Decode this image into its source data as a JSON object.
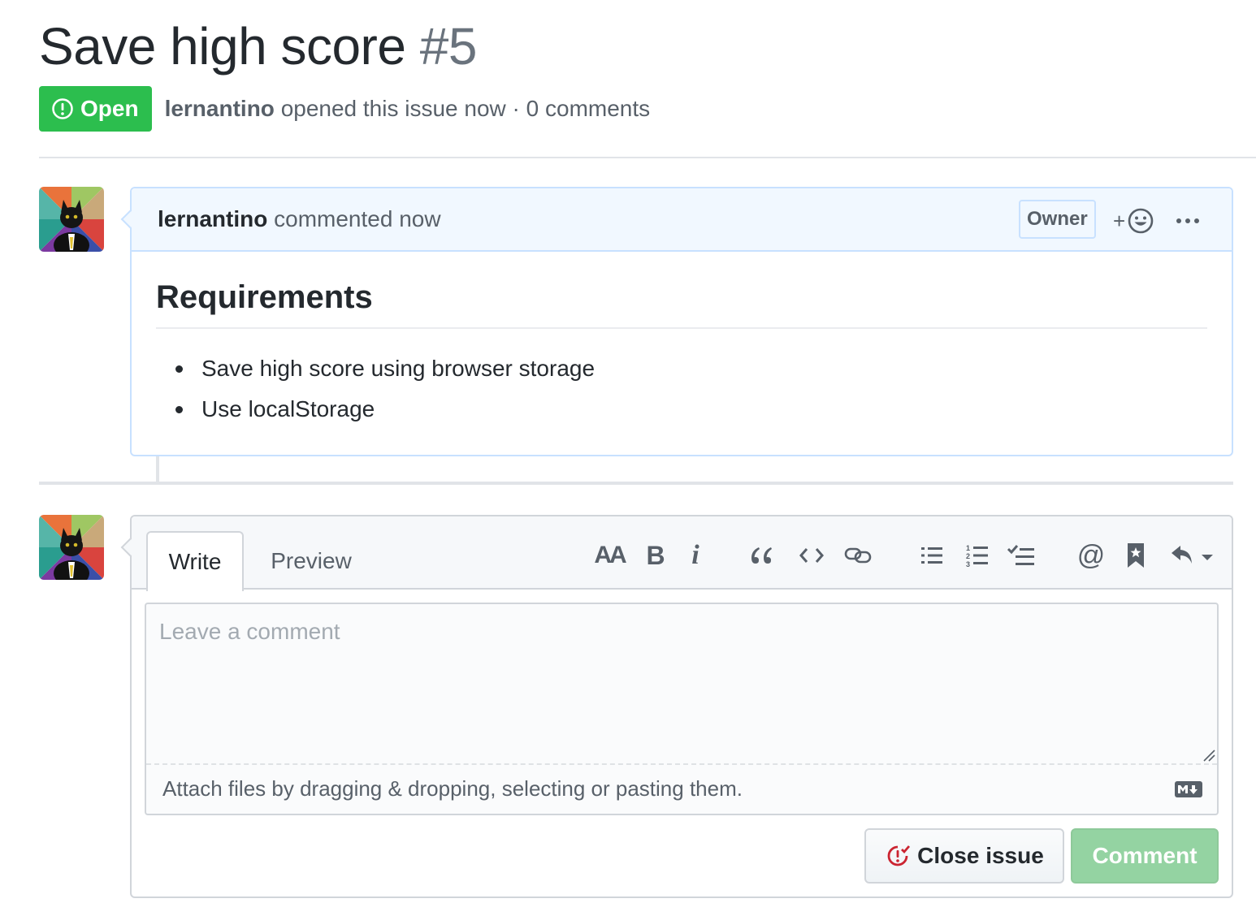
{
  "issue": {
    "title": "Save high score",
    "number": "#5",
    "state_label": "Open",
    "author": "lernantino",
    "meta_suffix": "opened this issue now · 0 comments"
  },
  "comment": {
    "author": "lernantino",
    "action": "commented now",
    "role_badge": "Owner",
    "reaction_plus": "+",
    "heading": "Requirements",
    "items": [
      "Save high score using browser storage",
      "Use localStorage"
    ]
  },
  "editor": {
    "tabs": [
      "Write",
      "Preview"
    ],
    "placeholder": "Leave a comment",
    "attach_text": "Attach files by dragging & dropping, selecting or pasting them.",
    "toolbar_text": {
      "heading": "AA",
      "bold": "B",
      "italic": "i",
      "mention": "@"
    },
    "toolbar_icons": [
      "text-size-icon",
      "bold-icon",
      "italic-icon",
      "quote-icon",
      "code-icon",
      "link-icon",
      "bullet-list-icon",
      "numbered-list-icon",
      "task-list-icon",
      "mention-icon",
      "saved-reply-icon",
      "reply-icon"
    ],
    "close_label": "Close issue",
    "comment_label": "Comment"
  },
  "colors": {
    "open_green": "#2cbe4e",
    "comment_disabled": "#94d3a2",
    "header_blue": "#f1f8ff",
    "close_red": "#cb2431"
  }
}
